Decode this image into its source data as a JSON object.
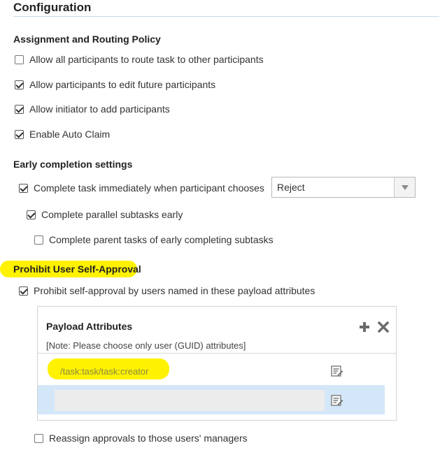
{
  "config": {
    "title": "Configuration"
  },
  "assignment": {
    "title": "Assignment and Routing Policy",
    "options": [
      {
        "label": "Allow all participants to route task to other participants",
        "checked": false
      },
      {
        "label": "Allow participants to edit future participants",
        "checked": true
      },
      {
        "label": "Allow initiator to add participants",
        "checked": true
      },
      {
        "label": "Enable Auto Claim",
        "checked": true
      }
    ]
  },
  "early": {
    "title": "Early completion settings",
    "complete_immediately": {
      "label": "Complete task immediately when participant chooses",
      "checked": true
    },
    "select_value": "Reject",
    "parallel": {
      "label": "Complete parallel subtasks early",
      "checked": true
    },
    "parent": {
      "label": "Complete parent tasks of early completing subtasks",
      "checked": false
    }
  },
  "prohibit": {
    "title": "Prohibit User Self-Approval",
    "option": {
      "label": "Prohibit self-approval by users named in these payload attributes",
      "checked": true
    },
    "panel": {
      "title": "Payload Attributes",
      "note": "[Note: Please choose only user (GUID) attributes]",
      "rows": [
        {
          "value": "/task:task/task:creator",
          "selected": false
        },
        {
          "value": "",
          "selected": true
        }
      ]
    },
    "reassign": {
      "label": "Reassign approvals to those users' managers",
      "checked": false
    }
  },
  "colors": {
    "highlight": "#fff200",
    "selected_row": "#d3e7f9"
  }
}
